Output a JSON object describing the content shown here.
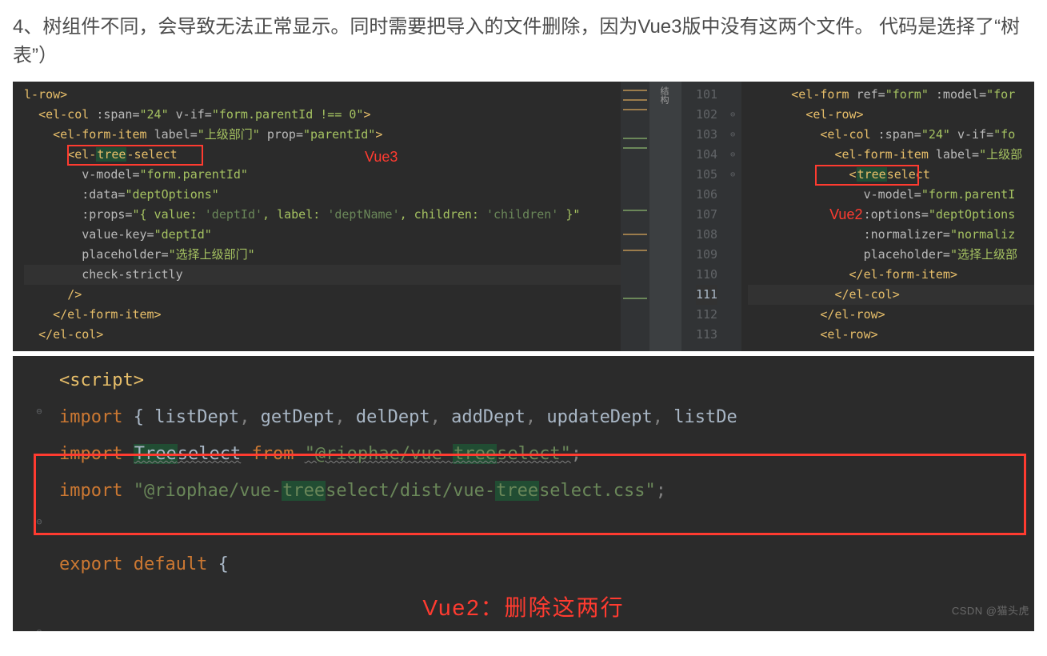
{
  "heading": "4、树组件不同，会导致无法正常显示。同时需要把导入的文件删除，因为Vue3版中没有这两个文件。 代码是选择了“树表”）",
  "labels": {
    "vue3": "Vue3",
    "vue2": "Vue2",
    "delete_two_lines": "Vue2：删除这两行",
    "sidebar_icon": "结构"
  },
  "leftPane": {
    "lines": [
      "l-row>",
      "  <el-col :span=\"24\" v-if=\"form.parentId !== 0\">",
      "    <el-form-item label=\"上级部门\" prop=\"parentId\">",
      "      <el-tree-select",
      "        v-model=\"form.parentId\"",
      "        :data=\"deptOptions\"",
      "        :props=\"{ value: 'deptId', label: 'deptName', children: 'children' }\"",
      "        value-key=\"deptId\"",
      "        placeholder=\"选择上级部门\"",
      "        check-strictly",
      "      />",
      "    </el-form-item>",
      "  </el-col>"
    ]
  },
  "rightPane": {
    "startLine": 101,
    "currentLine": 111,
    "lines": [
      "      <el-form ref=\"form\" :model=\"for",
      "        <el-row>",
      "          <el-col :span=\"24\" v-if=\"fo",
      "            <el-form-item label=\"上级部",
      "              <treeselect",
      "                v-model=\"form.parentI",
      "                :options=\"deptOptions",
      "                :normalizer=\"normaliz",
      "                placeholder=\"选择上级部",
      "              </el-form-item>",
      "            </el-col>",
      "          </el-row>",
      "          <el-row>"
    ]
  },
  "script_block": {
    "lines": [
      "<script>",
      "import { listDept, getDept, delDept, addDept, updateDept, listDe",
      "import Treeselect from \"@riophae/vue-treeselect\";",
      "import \"@riophae/vue-treeselect/dist/vue-treeselect.css\";",
      "",
      "export default {"
    ]
  },
  "watermark": "CSDN @猫头虎"
}
